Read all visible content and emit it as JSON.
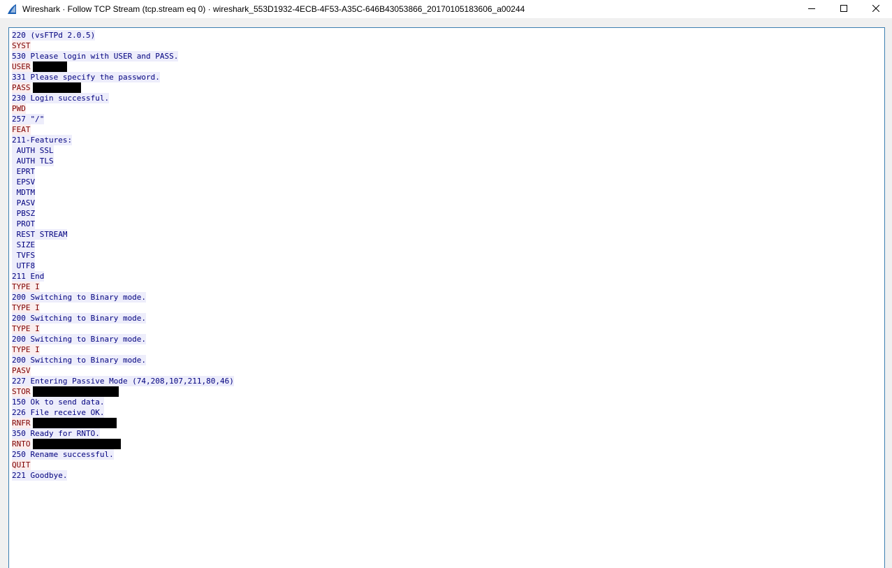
{
  "window": {
    "title": "Wireshark · Follow TCP Stream (tcp.stream eq 0) · wireshark_553D1932-4ECB-4F53-A35C-646B43053866_20170105183606_a00244",
    "icons": {
      "app": "wireshark-fin-icon",
      "minimize": "minimize-icon",
      "maximize": "maximize-icon",
      "close": "close-icon"
    }
  },
  "colors": {
    "client_text": "#7f0000",
    "client_bg": "#fbeded",
    "server_text": "#00007f",
    "server_bg": "#ededfb",
    "redaction": "#000000",
    "border": "#3c7fb1"
  },
  "stream": {
    "lines": [
      {
        "dir": "server",
        "text": "220 (vsFTPd 2.0.5)"
      },
      {
        "dir": "client",
        "text": "SYST"
      },
      {
        "dir": "server",
        "text": "530 Please login with USER and PASS."
      },
      {
        "dir": "client",
        "text": "USER",
        "redacted": true,
        "redact_w": 49
      },
      {
        "dir": "server",
        "text": "331 Please specify the password."
      },
      {
        "dir": "client",
        "text": "PASS",
        "redacted": true,
        "redact_w": 69
      },
      {
        "dir": "server",
        "text": "230 Login successful."
      },
      {
        "dir": "client",
        "text": "PWD"
      },
      {
        "dir": "server",
        "text": "257 \"/\""
      },
      {
        "dir": "client",
        "text": "FEAT"
      },
      {
        "dir": "server",
        "text": "211-Features:"
      },
      {
        "dir": "server",
        "text": " AUTH SSL"
      },
      {
        "dir": "server",
        "text": " AUTH TLS"
      },
      {
        "dir": "server",
        "text": " EPRT"
      },
      {
        "dir": "server",
        "text": " EPSV"
      },
      {
        "dir": "server",
        "text": " MDTM"
      },
      {
        "dir": "server",
        "text": " PASV"
      },
      {
        "dir": "server",
        "text": " PBSZ"
      },
      {
        "dir": "server",
        "text": " PROT"
      },
      {
        "dir": "server",
        "text": " REST STREAM"
      },
      {
        "dir": "server",
        "text": " SIZE"
      },
      {
        "dir": "server",
        "text": " TVFS"
      },
      {
        "dir": "server",
        "text": " UTF8"
      },
      {
        "dir": "server",
        "text": "211 End"
      },
      {
        "dir": "client",
        "text": "TYPE I"
      },
      {
        "dir": "server",
        "text": "200 Switching to Binary mode."
      },
      {
        "dir": "client",
        "text": "TYPE I"
      },
      {
        "dir": "server",
        "text": "200 Switching to Binary mode."
      },
      {
        "dir": "client",
        "text": "TYPE I"
      },
      {
        "dir": "server",
        "text": "200 Switching to Binary mode."
      },
      {
        "dir": "client",
        "text": "TYPE I"
      },
      {
        "dir": "server",
        "text": "200 Switching to Binary mode."
      },
      {
        "dir": "client",
        "text": "PASV"
      },
      {
        "dir": "server",
        "text": "227 Entering Passive Mode (74,208,107,211,80,46)"
      },
      {
        "dir": "client",
        "text": "STOR",
        "redacted": true,
        "redact_w": 123
      },
      {
        "dir": "server",
        "text": "150 Ok to send data."
      },
      {
        "dir": "server",
        "text": "226 File receive OK."
      },
      {
        "dir": "client",
        "text": "RNFR",
        "redacted": true,
        "redact_w": 120
      },
      {
        "dir": "server",
        "text": "350 Ready for RNTO."
      },
      {
        "dir": "client",
        "text": "RNTO",
        "redacted": true,
        "redact_w": 126
      },
      {
        "dir": "server",
        "text": "250 Rename successful."
      },
      {
        "dir": "client",
        "text": "QUIT"
      },
      {
        "dir": "server",
        "text": "221 Goodbye."
      }
    ]
  }
}
